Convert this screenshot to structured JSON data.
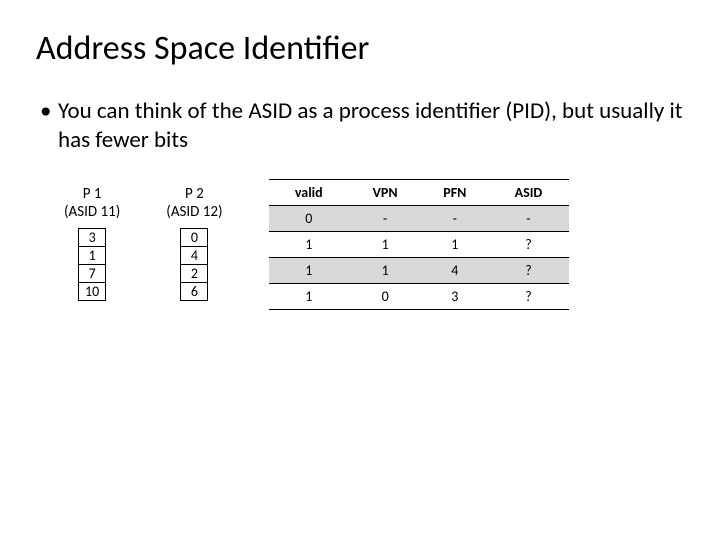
{
  "title": "Address Space Identifier",
  "bullet": "You can think of the ASID as a process identifier (PID), but usually it has fewer bits",
  "proc": [
    {
      "name": "P 1",
      "asid": "(ASID 11)",
      "cells": [
        "3",
        "1",
        "7",
        "10"
      ]
    },
    {
      "name": "P 2",
      "asid": "(ASID 12)",
      "cells": [
        "0",
        "4",
        "2",
        "6"
      ]
    }
  ],
  "tlb": {
    "headers": [
      "valid",
      "VPN",
      "PFN",
      "ASID"
    ],
    "rows": [
      [
        "0",
        "-",
        "-",
        "-"
      ],
      [
        "1",
        "1",
        "1",
        "?"
      ],
      [
        "1",
        "1",
        "4",
        "?"
      ],
      [
        "1",
        "0",
        "3",
        "?"
      ]
    ]
  }
}
